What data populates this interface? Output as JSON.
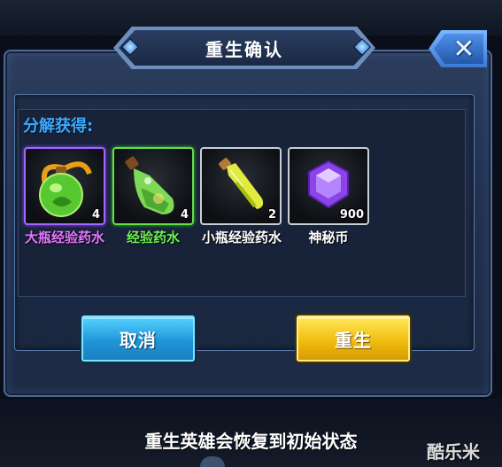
{
  "dialog": {
    "title": "重生确认",
    "close_label": "✕",
    "section_label": "分解获得:",
    "items": [
      {
        "name": "大瓶经验药水",
        "count": "4",
        "rarity": "purple",
        "name_color": "#e676ff",
        "icon": "large-exp-potion-icon"
      },
      {
        "name": "经验药水",
        "count": "4",
        "rarity": "green",
        "name_color": "#6df04f",
        "icon": "exp-potion-icon"
      },
      {
        "name": "小瓶经验药水",
        "count": "2",
        "rarity": "white",
        "name_color": "#ffffff",
        "icon": "small-exp-potion-icon"
      },
      {
        "name": "神秘币",
        "count": "900",
        "rarity": "white",
        "name_color": "#ffffff",
        "icon": "mystery-coin-icon"
      }
    ],
    "cancel_label": "取消",
    "confirm_label": "重生"
  },
  "footer": {
    "message": "重生英雄会恢复到初始状态",
    "watermark": "酷乐米"
  },
  "colors": {
    "section_label": "#38a9ff",
    "cancel_button": "#1f97d8",
    "confirm_button": "#f1be12"
  }
}
